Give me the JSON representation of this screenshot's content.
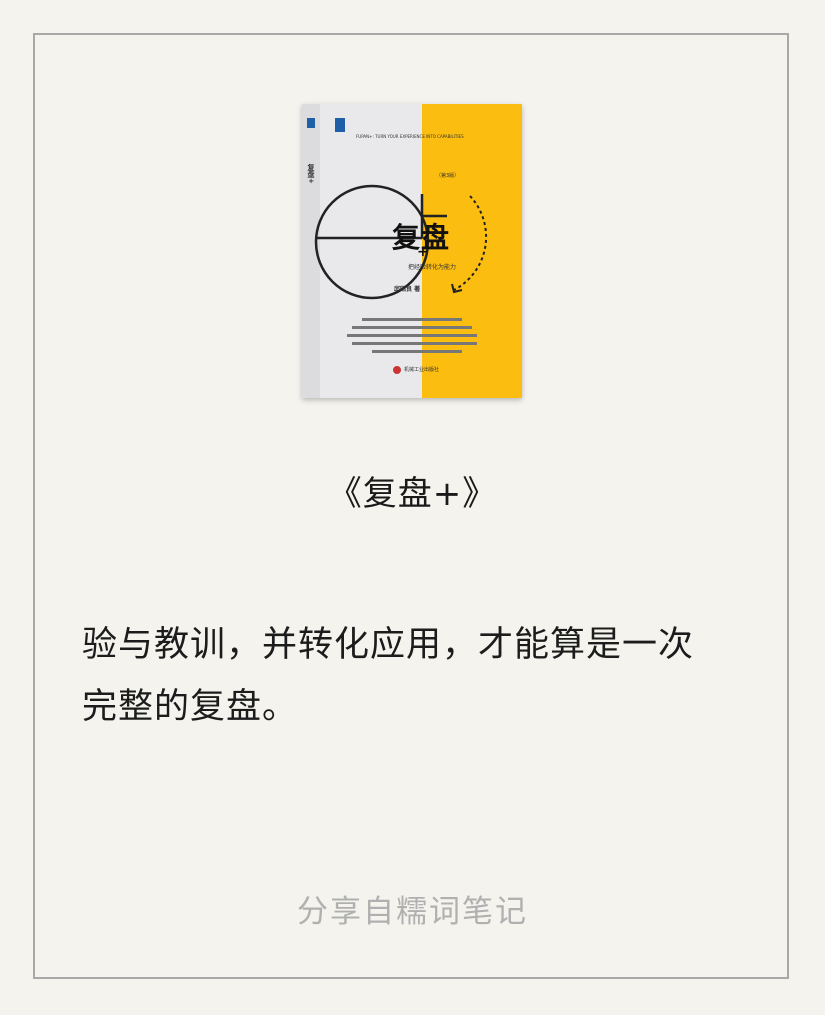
{
  "book": {
    "cover_top_line": "FUPAN+: TURN YOUR EXPERIENCE INTO CAPABILITIES",
    "cover_main_title": "复盘",
    "cover_plus": "+",
    "cover_subtitle": "把经验转化为能力",
    "cover_edition": "（第3版）",
    "cover_author": "邱昭良 著",
    "cover_publisher": "机械工业出版社",
    "cover_spine_title": "复盘+",
    "colors": {
      "left_panel": "#e9e9ec",
      "right_panel": "#fbbd10",
      "logo": "#1f5fa8"
    }
  },
  "title": "《复盘+》",
  "body": {
    "line1": "验与教训，并转化应用，才能算是一次",
    "line2": "完整的复盘。"
  },
  "footer": {
    "share_note": "分享自糯词笔记"
  }
}
